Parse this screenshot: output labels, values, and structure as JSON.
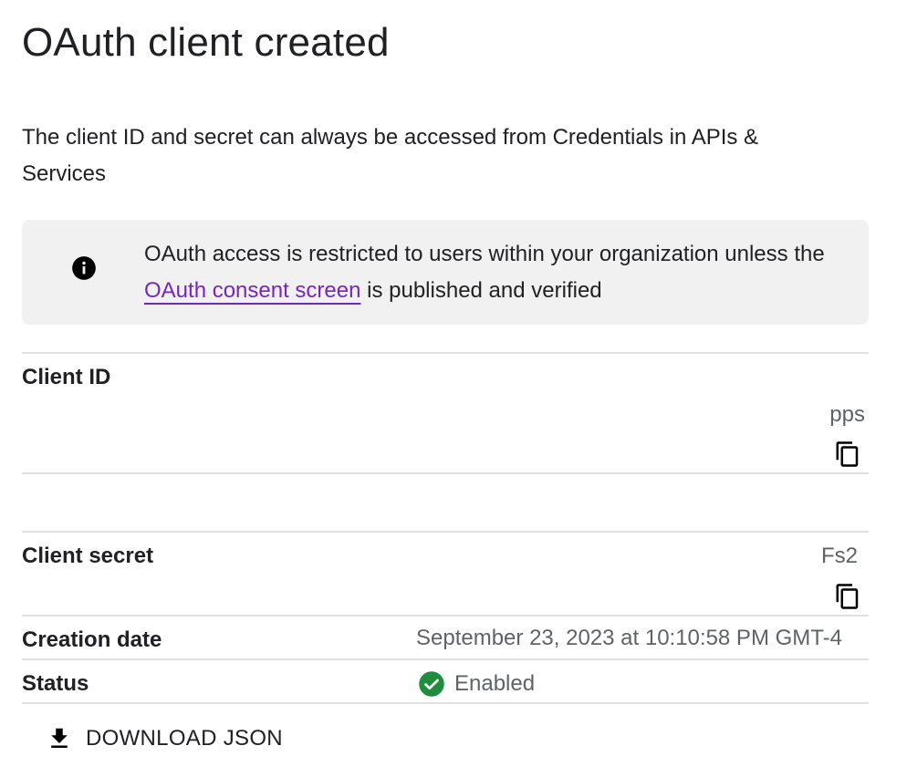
{
  "dialog": {
    "title": "OAuth client created",
    "subtitle": "The client ID and secret can always be accessed from Credentials in APIs & Services"
  },
  "banner": {
    "icon": "info-icon",
    "text_before": "OAuth access is restricted to users within your organization unless the ",
    "link_text": "OAuth consent screen",
    "text_after": " is published and verified",
    "link_color": "#7627bb"
  },
  "client_id": {
    "label": "Client ID",
    "value_visible": "pps",
    "copy_icon": "copy-icon"
  },
  "client_secret": {
    "label": "Client secret",
    "value_visible": "Fs2",
    "copy_icon": "copy-icon"
  },
  "creation_date": {
    "label": "Creation date",
    "value": "September 23, 2023 at 10:10:58 PM GMT-4"
  },
  "status": {
    "label": "Status",
    "value": "Enabled",
    "icon": "check-circle-icon",
    "color": "#1e8e3e"
  },
  "actions": {
    "download_label": "DOWNLOAD JSON",
    "download_icon": "download-icon"
  }
}
